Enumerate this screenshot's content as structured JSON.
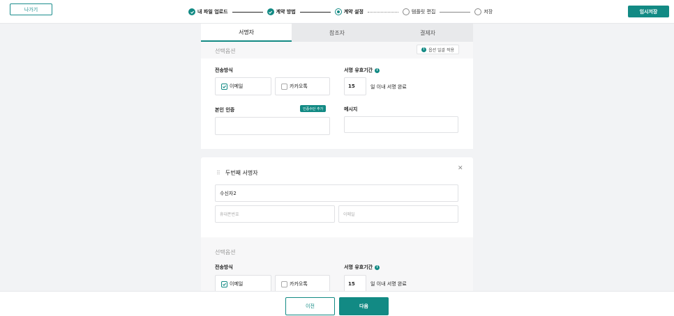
{
  "header": {
    "exit_label": "나가기",
    "temp_save_label": "임시저장",
    "steps": [
      {
        "label": "내 파일 업로드",
        "state": "done"
      },
      {
        "label": "계약 방법",
        "state": "done"
      },
      {
        "label": "계약 설정",
        "state": "current"
      },
      {
        "label": "템플릿 편집",
        "state": "todo"
      },
      {
        "label": "저장",
        "state": "todo"
      }
    ]
  },
  "tabs": [
    "서명자",
    "참조자",
    "결제자"
  ],
  "signer1": {
    "options_title": "선택옵션",
    "apply_all_label": "옵션 일괄 적용",
    "delivery_label": "전송방식",
    "delivery_email": "이메일",
    "delivery_kakao": "카카오톡",
    "validity_label": "서명 유효기간",
    "validity_days": "15",
    "validity_suffix": "일 이내 서명 완료",
    "auth_label": "본인 인증",
    "add_auth_label": "인증수단 추가",
    "message_label": "메시지"
  },
  "signer2": {
    "title": "두번째 서명자",
    "name_value": "수신자2",
    "phone_placeholder": "휴대폰번호",
    "email_placeholder": "이메일",
    "options_title": "선택옵션",
    "delivery_label": "전송방식",
    "delivery_email": "이메일",
    "delivery_kakao": "카카오톡",
    "validity_label": "서명 유효기간",
    "validity_days": "15",
    "validity_suffix": "일 이내 서명 완료"
  },
  "footer": {
    "prev_label": "이전",
    "next_label": "다음"
  },
  "colors": {
    "accent": "#128a84"
  }
}
